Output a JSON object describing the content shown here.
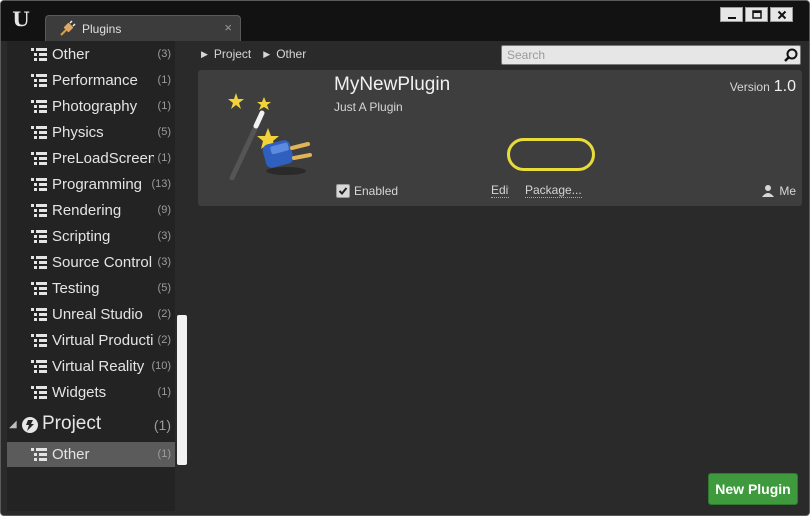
{
  "window": {
    "tab_title": "Plugins",
    "tab_close": "×",
    "tab_icon": "plug-icon",
    "logo": "unreal-engine-logo",
    "controls": {
      "minimize": "minimize-icon",
      "maximize": "maximize-icon",
      "close": "close-icon"
    }
  },
  "sidebar": {
    "categories": [
      {
        "label": "Other",
        "count": "(3)"
      },
      {
        "label": "Performance",
        "count": "(1)"
      },
      {
        "label": "Photography",
        "count": "(1)"
      },
      {
        "label": "Physics",
        "count": "(5)"
      },
      {
        "label": "PreLoadScreen",
        "count": "(1)"
      },
      {
        "label": "Programming",
        "count": "(13)"
      },
      {
        "label": "Rendering",
        "count": "(9)"
      },
      {
        "label": "Scripting",
        "count": "(3)"
      },
      {
        "label": "Source Control",
        "count": "(3)"
      },
      {
        "label": "Testing",
        "count": "(5)"
      },
      {
        "label": "Unreal Studio",
        "count": "(2)"
      },
      {
        "label": "Virtual Production",
        "count": "(2)"
      },
      {
        "label": "Virtual Reality",
        "count": "(10)"
      },
      {
        "label": "Widgets",
        "count": "(1)"
      }
    ],
    "project": {
      "label": "Project",
      "count": "(1)",
      "expand_icon": "triangle-down-icon",
      "children": [
        {
          "label": "Other",
          "count": "(1)",
          "selected": true
        }
      ]
    }
  },
  "breadcrumb": [
    "Project",
    "Other"
  ],
  "search": {
    "placeholder": "Search",
    "value": ""
  },
  "plugin": {
    "name": "MyNewPlugin",
    "description": "Just A Plugin",
    "version_label": "Version",
    "version": "1.0",
    "enabled_label": "Enabled",
    "enabled": true,
    "edit_label": "Edit...",
    "package_label": "Package...",
    "author": "Me",
    "thumbnail_icon": "magic-wand-plug-icon"
  },
  "new_plugin_button": "New Plugin",
  "colors": {
    "highlight": "#e8dc3a",
    "new_plugin": "#3e9a3c",
    "selected_row": "#5b5b5b"
  }
}
